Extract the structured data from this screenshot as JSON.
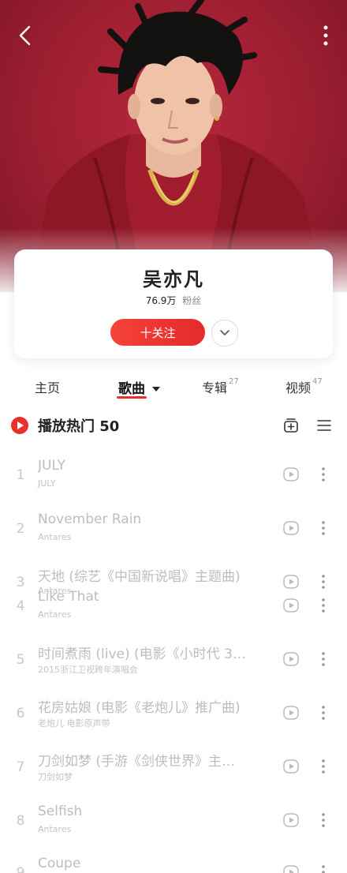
{
  "artist": {
    "name": "吴亦凡",
    "fan_count": "76.9万",
    "fan_label": "粉丝",
    "follow_label": "十关注"
  },
  "tabs": [
    {
      "label": "主页",
      "count": ""
    },
    {
      "label": "歌曲",
      "count": ""
    },
    {
      "label": "专辑",
      "count": "27"
    },
    {
      "label": "视频",
      "count": "47"
    }
  ],
  "section": {
    "title": "播放热门 50"
  },
  "songs": [
    {
      "num": "1",
      "title": "JULY",
      "sub": "JULY"
    },
    {
      "num": "2",
      "title": "November Rain",
      "sub": "Antares"
    },
    {
      "num": "3",
      "title": "天地 (综艺《中国新说唱》主题曲)",
      "sub": "Antares"
    },
    {
      "num": "4",
      "title": "Like That",
      "sub": "Antares"
    },
    {
      "num": "5",
      "title": "时间煮雨 (live) (电影《小时代 3…",
      "sub": "2015浙江卫视跨年演唱会"
    },
    {
      "num": "6",
      "title": "花房姑娘 (电影《老炮儿》推广曲)",
      "sub": "老炮儿 电影原声带"
    },
    {
      "num": "7",
      "title": "刀剑如梦 (手游《剑侠世界》主…",
      "sub": "刀剑如梦"
    },
    {
      "num": "8",
      "title": "Selfish",
      "sub": "Antares"
    },
    {
      "num": "9",
      "title": "Coupe",
      "sub": ""
    }
  ],
  "icons": {
    "back": "chevron-left-icon",
    "more": "more-vertical-icon",
    "expand": "chevron-down-icon",
    "play_all": "play-circle-icon",
    "add_to_playlist": "add-playlist-icon",
    "multi_select": "list-icon",
    "song_play": "play-video-icon",
    "song_more": "more-vertical-icon"
  },
  "colors": {
    "accent": "#e8312c",
    "hero_bg": "#a52236"
  }
}
